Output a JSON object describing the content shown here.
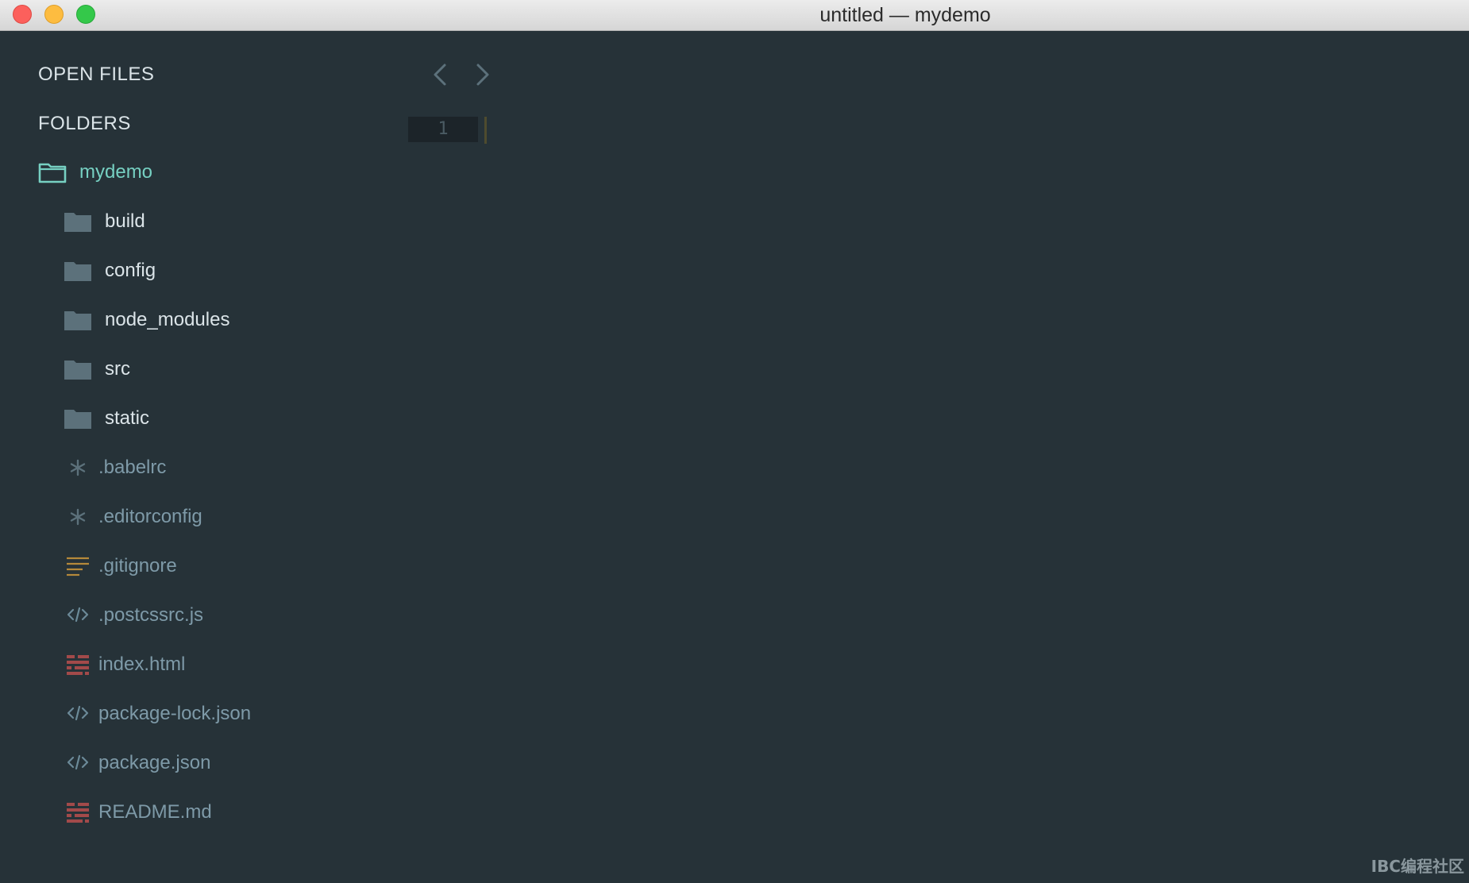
{
  "window": {
    "title": "untitled — mydemo"
  },
  "sidebar": {
    "open_files_title": "OPEN FILES",
    "folders_title": "FOLDERS",
    "root": {
      "label": "mydemo",
      "icon": "open-folder-icon"
    },
    "folders": [
      {
        "label": "build",
        "icon": "folder-icon"
      },
      {
        "label": "config",
        "icon": "folder-icon"
      },
      {
        "label": "node_modules",
        "icon": "folder-icon"
      },
      {
        "label": "src",
        "icon": "folder-icon"
      },
      {
        "label": "static",
        "icon": "folder-icon"
      }
    ],
    "files": [
      {
        "label": ".babelrc",
        "icon": "asterisk-icon"
      },
      {
        "label": ".editorconfig",
        "icon": "asterisk-icon"
      },
      {
        "label": ".gitignore",
        "icon": "lines-icon"
      },
      {
        "label": ".postcssrc.js",
        "icon": "code-icon"
      },
      {
        "label": "index.html",
        "icon": "markup-icon"
      },
      {
        "label": "package-lock.json",
        "icon": "code-icon"
      },
      {
        "label": "package.json",
        "icon": "code-icon"
      },
      {
        "label": "README.md",
        "icon": "markup-icon"
      }
    ]
  },
  "editor": {
    "line_number": "1",
    "nav_back_icon": "chevron-left-icon",
    "nav_forward_icon": "chevron-right-icon"
  },
  "watermark": "IBC编程社区",
  "colors": {
    "background": "#263238",
    "root_folder": "#76d0c2",
    "folder": "#5c717b",
    "folder_label": "#dbe4e8",
    "file_label": "#7e9aa8",
    "asterisk": "#5c717b",
    "lines": "#b5893a",
    "code": "#6b8a98",
    "markup": "#a24a4a"
  }
}
